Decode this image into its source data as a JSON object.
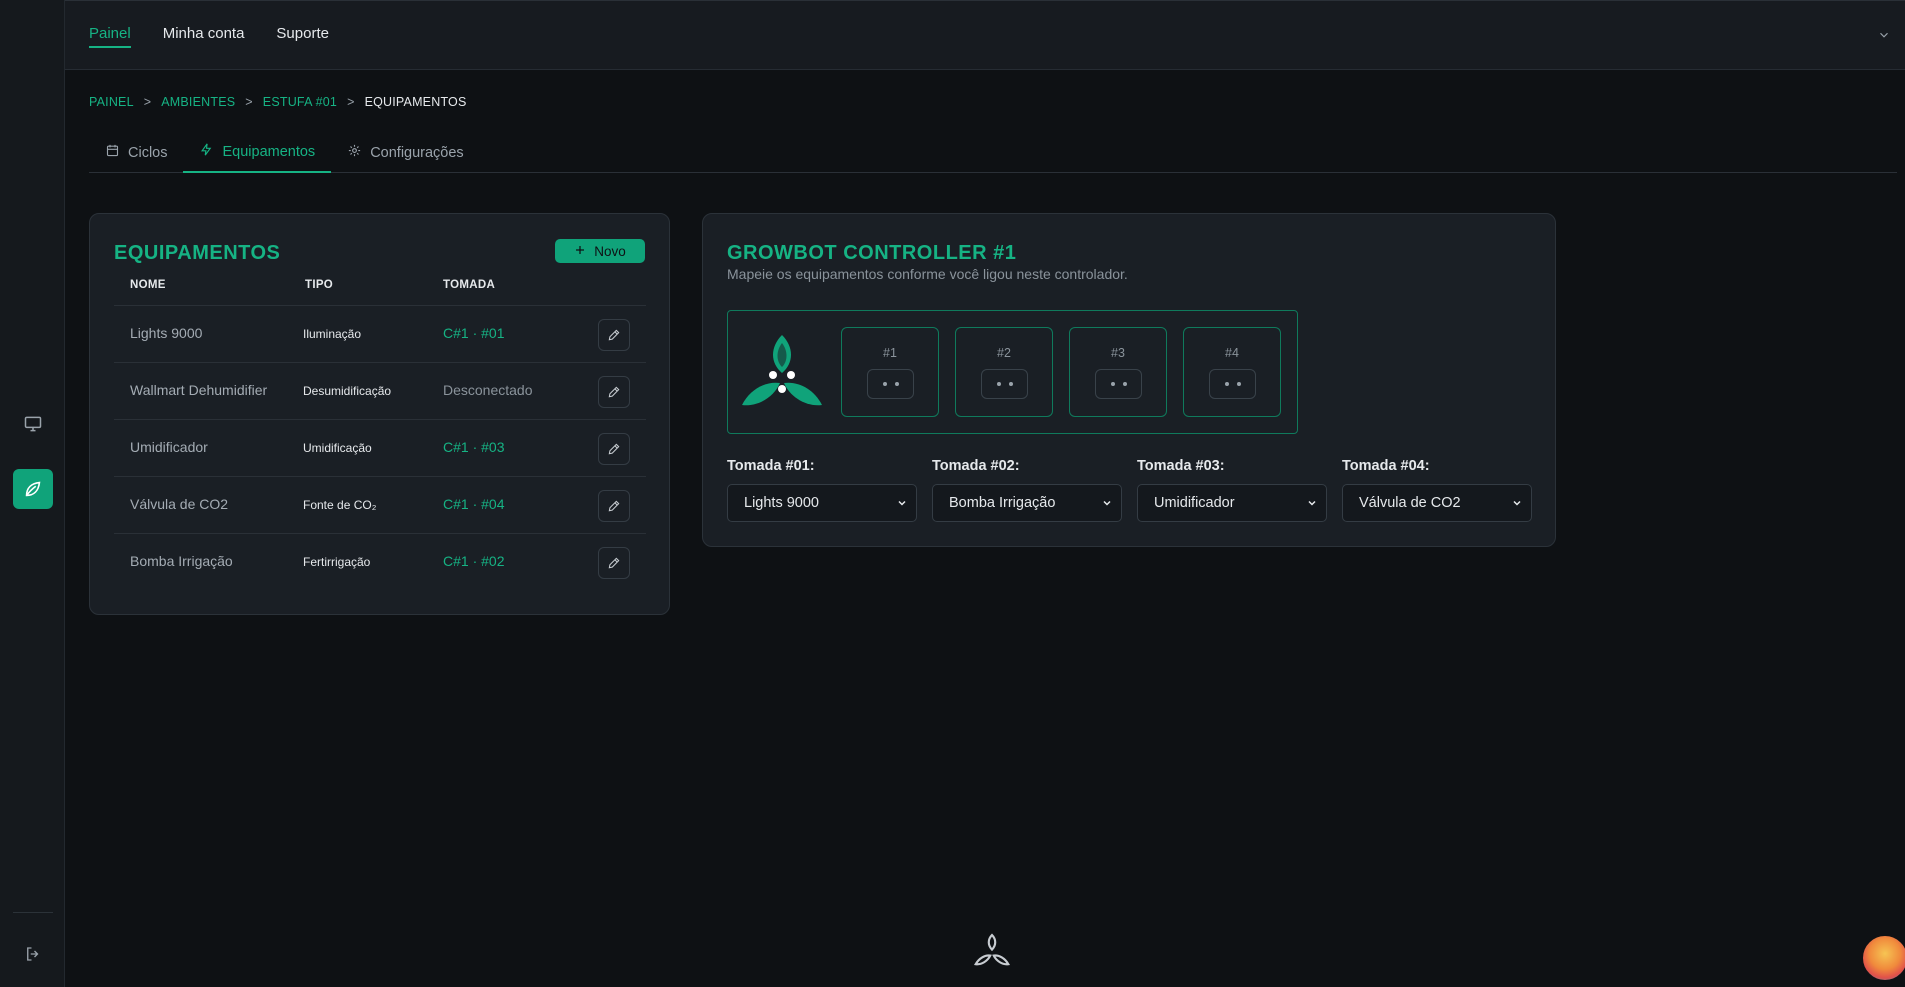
{
  "topnav": {
    "items": [
      "Painel",
      "Minha conta",
      "Suporte"
    ]
  },
  "breadcrumb": {
    "b1": "PAINEL",
    "b2": "AMBIENTES",
    "b3": "ESTUFA #01",
    "b4": "EQUIPAMENTOS",
    "sep": ">"
  },
  "tabs": {
    "ciclos": "Ciclos",
    "equipamentos": "Equipamentos",
    "configuracoes": "Configurações"
  },
  "equipamentos": {
    "title": "EQUIPAMENTOS",
    "new_label": "Novo",
    "headers": {
      "nome": "NOME",
      "tipo": "TIPO",
      "tomada": "TOMADA"
    },
    "rows": [
      {
        "nome": "Lights 9000",
        "tipo": "Iluminação",
        "tomada": "C#1 · #01"
      },
      {
        "nome": "Wallmart Dehumidifier",
        "tipo": "Desumidificação",
        "tomada": "Desconectado"
      },
      {
        "nome": "Umidificador",
        "tipo": "Umidificação",
        "tomada": "C#1 · #03"
      },
      {
        "nome": "Válvula de CO2",
        "tipo": "Fonte de CO₂",
        "tomada": "C#1 · #04"
      },
      {
        "nome": "Bomba Irrigação",
        "tipo": "Fertirrigação",
        "tomada": "C#1 · #02"
      }
    ]
  },
  "controller": {
    "title": "GROWBOT CONTROLLER #1",
    "subtitle": "Mapeie os equipamentos conforme você ligou neste controlador.",
    "sockets": [
      "#1",
      "#2",
      "#3",
      "#4"
    ],
    "selects": [
      {
        "label": "Tomada #01:",
        "value": "Lights 9000"
      },
      {
        "label": "Tomada #02:",
        "value": "Bomba Irrigação"
      },
      {
        "label": "Tomada #03:",
        "value": "Umidificador"
      },
      {
        "label": "Tomada #04:",
        "value": "Válvula de CO2"
      }
    ]
  },
  "colors": {
    "accent": "#16b384",
    "accent_button": "#10a37a",
    "background": "#0e1114",
    "card": "#1a1f25"
  },
  "icons": [
    "monitor-icon",
    "leaf-icon",
    "logout-icon",
    "calendar-icon",
    "bolt-icon",
    "gear-icon",
    "plus-icon",
    "pencil-icon",
    "chevron-down-icon",
    "growbot-logo"
  ]
}
